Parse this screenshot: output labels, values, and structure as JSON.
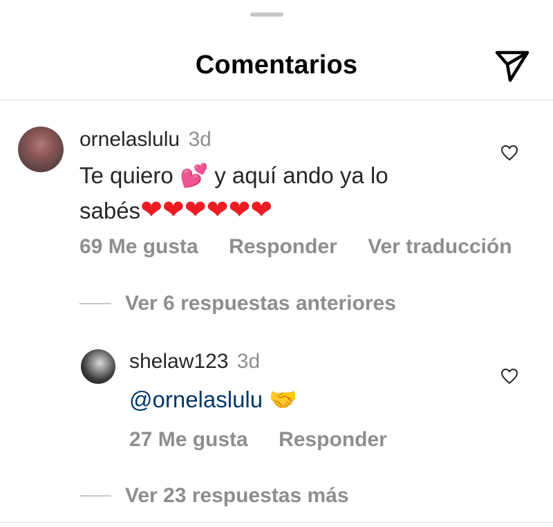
{
  "header": {
    "title": "Comentarios",
    "send_icon": "send-paper-plane-icon"
  },
  "comment": {
    "username": "ornelaslulu",
    "time": "3d",
    "text_part1": "Te quiero",
    "emoji_hearts": "💕",
    "text_part2": " y aquí ando ya lo",
    "text_line2": "sabés",
    "hearts": [
      "❤",
      "❤",
      "❤",
      "❤",
      "❤",
      "❤"
    ],
    "likes": "69 Me gusta",
    "reply": "Responder",
    "translate": "Ver traducción",
    "view_previous": "Ver 6 respuestas anteriores"
  },
  "reply": {
    "username": "shelaw123",
    "time": "3d",
    "mention": "@ornelaslulu",
    "emoji": "🤝",
    "likes": "27 Me gusta",
    "reply": "Responder",
    "view_more": "Ver 23 respuestas más"
  },
  "colors": {
    "secondary_text": "#8e8e8e",
    "mention": "#00376b",
    "heart": "#ed1c24",
    "divider": "#dbdbdb"
  }
}
